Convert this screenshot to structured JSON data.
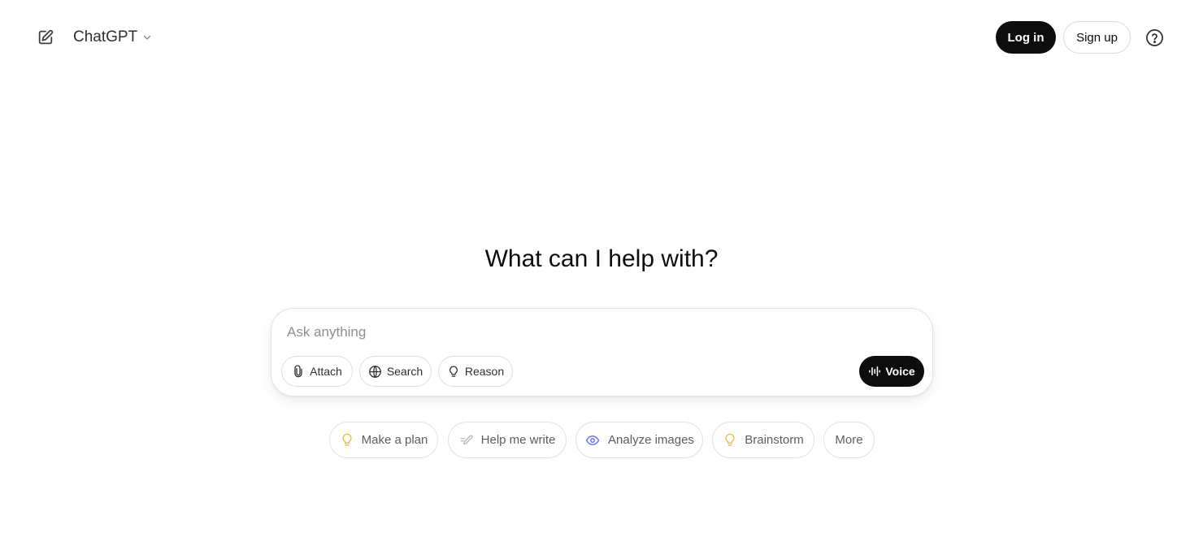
{
  "header": {
    "model_name": "ChatGPT",
    "login_label": "Log in",
    "signup_label": "Sign up",
    "icons": {
      "new_chat": "edit-icon",
      "model_dropdown": "chevron-down-icon",
      "help": "help-circle-icon"
    }
  },
  "main": {
    "heading": "What can I help with?"
  },
  "composer": {
    "placeholder": "Ask anything",
    "value": "",
    "tools": [
      {
        "label": "Attach",
        "icon": "paperclip-icon"
      },
      {
        "label": "Search",
        "icon": "globe-icon"
      },
      {
        "label": "Reason",
        "icon": "lightbulb-icon"
      }
    ],
    "voice_label": "Voice",
    "voice_icon": "waveform-icon"
  },
  "suggestions": [
    {
      "label": "Make a plan",
      "icon": "lightbulb-icon",
      "icon_color": "#e2c541"
    },
    {
      "label": "Help me write",
      "icon": "pen-icon",
      "icon_color": "#b4b4b4"
    },
    {
      "label": "Analyze images",
      "icon": "eye-icon",
      "icon_color": "#6c71ff"
    },
    {
      "label": "Brainstorm",
      "icon": "lightbulb-icon",
      "icon_color": "#e2c541"
    },
    {
      "label": "More",
      "icon": "",
      "icon_color": ""
    }
  ],
  "colors": {
    "primary_button": "#0d0d0d",
    "border": "#e2e2e2",
    "muted_text": "#5d5d5d",
    "placeholder": "#8f8f8f"
  }
}
